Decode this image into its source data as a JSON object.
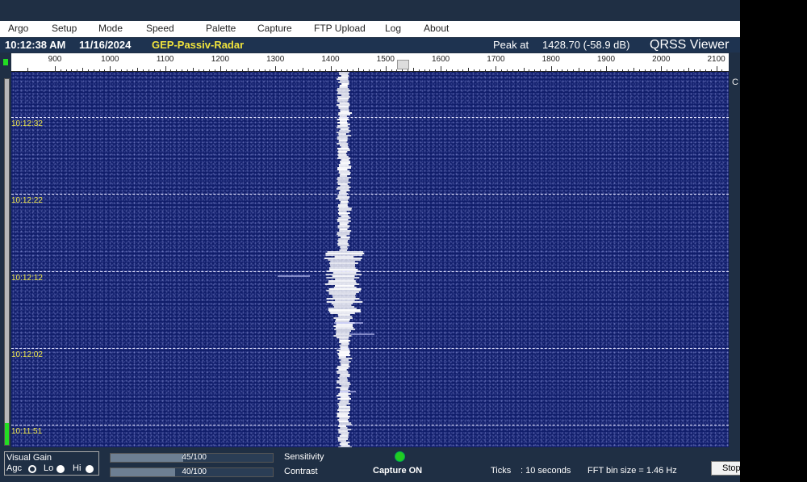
{
  "menu": [
    "Argo",
    "Setup",
    "Mode",
    "Speed",
    "Palette",
    "Capture",
    "FTP Upload",
    "Log",
    "About"
  ],
  "info": {
    "time": "10:12:38 AM",
    "date": "11/16/2024",
    "station": "GEP-Passiv-Radar",
    "peak_label": "Peak at",
    "peak_value": "1428.70 (-58.9 dB)",
    "brand": "QRSS Viewer"
  },
  "ruler": {
    "ticks": [
      "900",
      "1000",
      "1100",
      "1200",
      "1300",
      "1400",
      "1500",
      "1600",
      "1700",
      "1800",
      "1900",
      "2000",
      "2100"
    ]
  },
  "waterfall": {
    "time_labels": [
      "10:12:32",
      "10:12:22",
      "10:12:12",
      "10:12:02",
      "10:11:51"
    ],
    "background_color": "#101d6a",
    "signal_color": "#ffffff",
    "label_color": "#f0e84a"
  },
  "side": {
    "stray_letter": "C"
  },
  "status": {
    "visual_gain_title": "Visual Gain",
    "agc_label": "Agc",
    "lo_label": "Lo",
    "hi_label": "Hi",
    "selected_gain": "Agc",
    "sensitivity": {
      "text": "45/100",
      "value": 45,
      "max": 100,
      "label": "Sensitivity"
    },
    "contrast": {
      "text": "40/100",
      "value": 40,
      "max": 100,
      "label": "Contrast"
    },
    "capture_text": "Capture ON",
    "ticks_label": "Ticks",
    "ticks_value": ": 10 seconds",
    "fft_label": "FFT bin size = 1.46 Hz",
    "stop_label": "Stop"
  },
  "level_meter_fraction": 0.06
}
